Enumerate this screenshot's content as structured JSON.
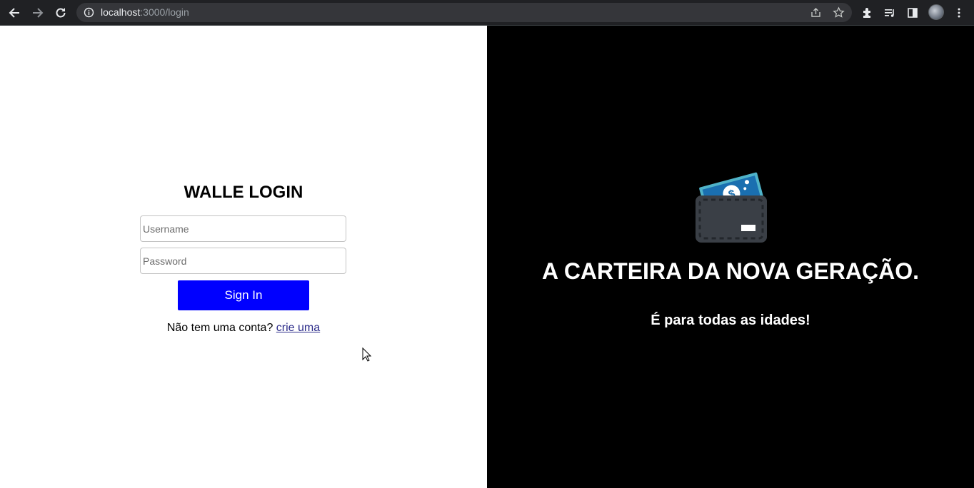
{
  "browser": {
    "url_host": "localhost",
    "url_path": ":3000/login"
  },
  "login": {
    "title": "WALLE LOGIN",
    "username_placeholder": "Username",
    "password_placeholder": "Password",
    "signin_label": "Sign In",
    "no_account_text": "Não tem uma conta? ",
    "signup_link": "crie uma"
  },
  "hero": {
    "icon": "wallet-icon",
    "headline": "A CARTEIRA DA NOVA GERAÇÃO.",
    "subline": "É para todas as idades!"
  },
  "colors": {
    "button": "#0000ff",
    "chrome": "#202124",
    "hero_bg": "#000000"
  }
}
